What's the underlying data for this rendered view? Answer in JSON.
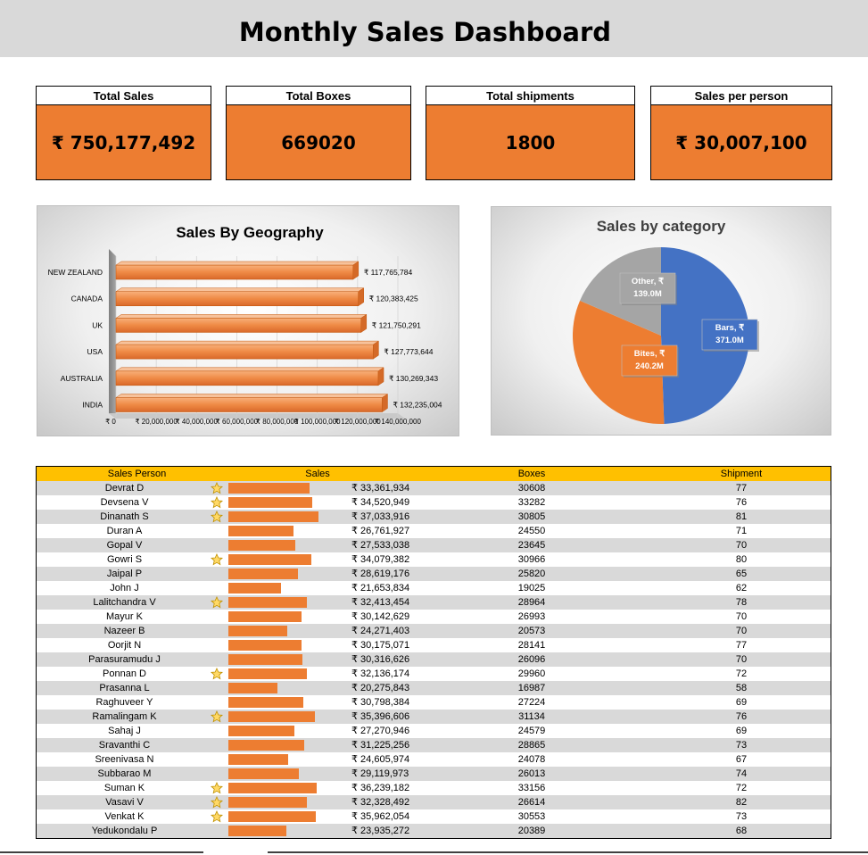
{
  "title": "Monthly Sales Dashboard",
  "kpis": [
    {
      "label": "Total Sales",
      "value": "₹ 750,177,492"
    },
    {
      "label": "Total Boxes",
      "value": "669020"
    },
    {
      "label": "Total shipments",
      "value": "1800"
    },
    {
      "label": "Sales per person",
      "value": "₹ 30,007,100"
    }
  ],
  "colors": {
    "accent": "#ed7d31",
    "header_bg": "#d9d9d9",
    "table_header": "#ffc000",
    "pie_blue": "#4472c4",
    "pie_gray": "#a5a5a5"
  },
  "chart_data": [
    {
      "type": "bar",
      "orientation": "horizontal",
      "title": "Sales By Geography",
      "categories": [
        "NEW ZEALAND",
        "CANADA",
        "UK",
        "USA",
        "AUSTRALIA",
        "INDIA"
      ],
      "values": [
        117765784,
        120383425,
        121750291,
        127773644,
        130269343,
        132235004
      ],
      "data_labels": [
        "₹ 117,765,784",
        "₹ 120,383,425",
        "₹ 121,750,291",
        "₹ 127,773,644",
        "₹ 130,269,343",
        "₹ 132,235,004"
      ],
      "x_ticks": [
        "₹ 0",
        "₹ 20,000,000",
        "₹ 40,000,000",
        "₹ 60,000,000",
        "₹ 80,000,000",
        "₹ 100,000,000",
        "₹ 120,000,000",
        "₹ 140,000,000"
      ],
      "xlim": [
        0,
        140000000
      ]
    },
    {
      "type": "pie",
      "title": "Sales by category",
      "slices": [
        {
          "name": "Bars",
          "value": 371.0,
          "label": "Bars, ₹ 371.0M",
          "label_lines": [
            "Bars, ₹",
            "371.0M"
          ],
          "color": "#4472c4"
        },
        {
          "name": "Bites",
          "value": 240.2,
          "label": "Bites, ₹ 240.2M",
          "label_lines": [
            "Bites, ₹",
            "240.2M"
          ],
          "color": "#ed7d31"
        },
        {
          "name": "Other",
          "value": 139.0,
          "label": "Other, ₹ 139.0M",
          "label_lines": [
            "Other, ₹",
            "139.0M"
          ],
          "color": "#a5a5a5"
        }
      ]
    }
  ],
  "table": {
    "headers": [
      "Sales Person",
      "Sales",
      "Boxes",
      "Shipment"
    ],
    "rows": [
      {
        "name": "Devrat D",
        "star": true,
        "sales": 33361934,
        "sales_text": "₹ 33,361,934",
        "boxes": "30608",
        "shipment": "77"
      },
      {
        "name": "Devsena V",
        "star": true,
        "sales": 34520949,
        "sales_text": "₹ 34,520,949",
        "boxes": "33282",
        "shipment": "76"
      },
      {
        "name": "Dinanath S",
        "star": true,
        "sales": 37033916,
        "sales_text": "₹ 37,033,916",
        "boxes": "30805",
        "shipment": "81"
      },
      {
        "name": "Duran A",
        "star": false,
        "sales": 26761927,
        "sales_text": "₹ 26,761,927",
        "boxes": "24550",
        "shipment": "71"
      },
      {
        "name": "Gopal V",
        "star": false,
        "sales": 27533038,
        "sales_text": "₹ 27,533,038",
        "boxes": "23645",
        "shipment": "70"
      },
      {
        "name": "Gowri S",
        "star": true,
        "sales": 34079382,
        "sales_text": "₹ 34,079,382",
        "boxes": "30966",
        "shipment": "80"
      },
      {
        "name": "Jaipal P",
        "star": false,
        "sales": 28619176,
        "sales_text": "₹ 28,619,176",
        "boxes": "25820",
        "shipment": "65"
      },
      {
        "name": "John J",
        "star": false,
        "sales": 21653834,
        "sales_text": "₹ 21,653,834",
        "boxes": "19025",
        "shipment": "62"
      },
      {
        "name": "Lalitchandra V",
        "star": true,
        "sales": 32413454,
        "sales_text": "₹ 32,413,454",
        "boxes": "28964",
        "shipment": "78"
      },
      {
        "name": "Mayur K",
        "star": false,
        "sales": 30142629,
        "sales_text": "₹ 30,142,629",
        "boxes": "26993",
        "shipment": "70"
      },
      {
        "name": "Nazeer B",
        "star": false,
        "sales": 24271403,
        "sales_text": "₹ 24,271,403",
        "boxes": "20573",
        "shipment": "70"
      },
      {
        "name": "Oorjit N",
        "star": false,
        "sales": 30175071,
        "sales_text": "₹ 30,175,071",
        "boxes": "28141",
        "shipment": "77"
      },
      {
        "name": "Parasuramudu J",
        "star": false,
        "sales": 30316626,
        "sales_text": "₹ 30,316,626",
        "boxes": "26096",
        "shipment": "70"
      },
      {
        "name": "Ponnan D",
        "star": true,
        "sales": 32136174,
        "sales_text": "₹ 32,136,174",
        "boxes": "29960",
        "shipment": "72"
      },
      {
        "name": "Prasanna L",
        "star": false,
        "sales": 20275843,
        "sales_text": "₹ 20,275,843",
        "boxes": "16987",
        "shipment": "58"
      },
      {
        "name": "Raghuveer Y",
        "star": false,
        "sales": 30798384,
        "sales_text": "₹ 30,798,384",
        "boxes": "27224",
        "shipment": "69"
      },
      {
        "name": "Ramalingam K",
        "star": true,
        "sales": 35396606,
        "sales_text": "₹ 35,396,606",
        "boxes": "31134",
        "shipment": "76"
      },
      {
        "name": "Sahaj J",
        "star": false,
        "sales": 27270946,
        "sales_text": "₹ 27,270,946",
        "boxes": "24579",
        "shipment": "69"
      },
      {
        "name": "Sravanthi C",
        "star": false,
        "sales": 31225256,
        "sales_text": "₹ 31,225,256",
        "boxes": "28865",
        "shipment": "73"
      },
      {
        "name": "Sreenivasa N",
        "star": false,
        "sales": 24605974,
        "sales_text": "₹ 24,605,974",
        "boxes": "24078",
        "shipment": "67"
      },
      {
        "name": "Subbarao M",
        "star": false,
        "sales": 29119973,
        "sales_text": "₹ 29,119,973",
        "boxes": "26013",
        "shipment": "74"
      },
      {
        "name": "Suman K",
        "star": true,
        "sales": 36239182,
        "sales_text": "₹ 36,239,182",
        "boxes": "33156",
        "shipment": "72"
      },
      {
        "name": "Vasavi V",
        "star": true,
        "sales": 32328492,
        "sales_text": "₹ 32,328,492",
        "boxes": "26614",
        "shipment": "82"
      },
      {
        "name": "Venkat K",
        "star": true,
        "sales": 35962054,
        "sales_text": "₹ 35,962,054",
        "boxes": "30553",
        "shipment": "73"
      },
      {
        "name": "Yedukondalu P",
        "star": false,
        "sales": 23935272,
        "sales_text": "₹ 23,935,272",
        "boxes": "20389",
        "shipment": "68"
      }
    ]
  }
}
